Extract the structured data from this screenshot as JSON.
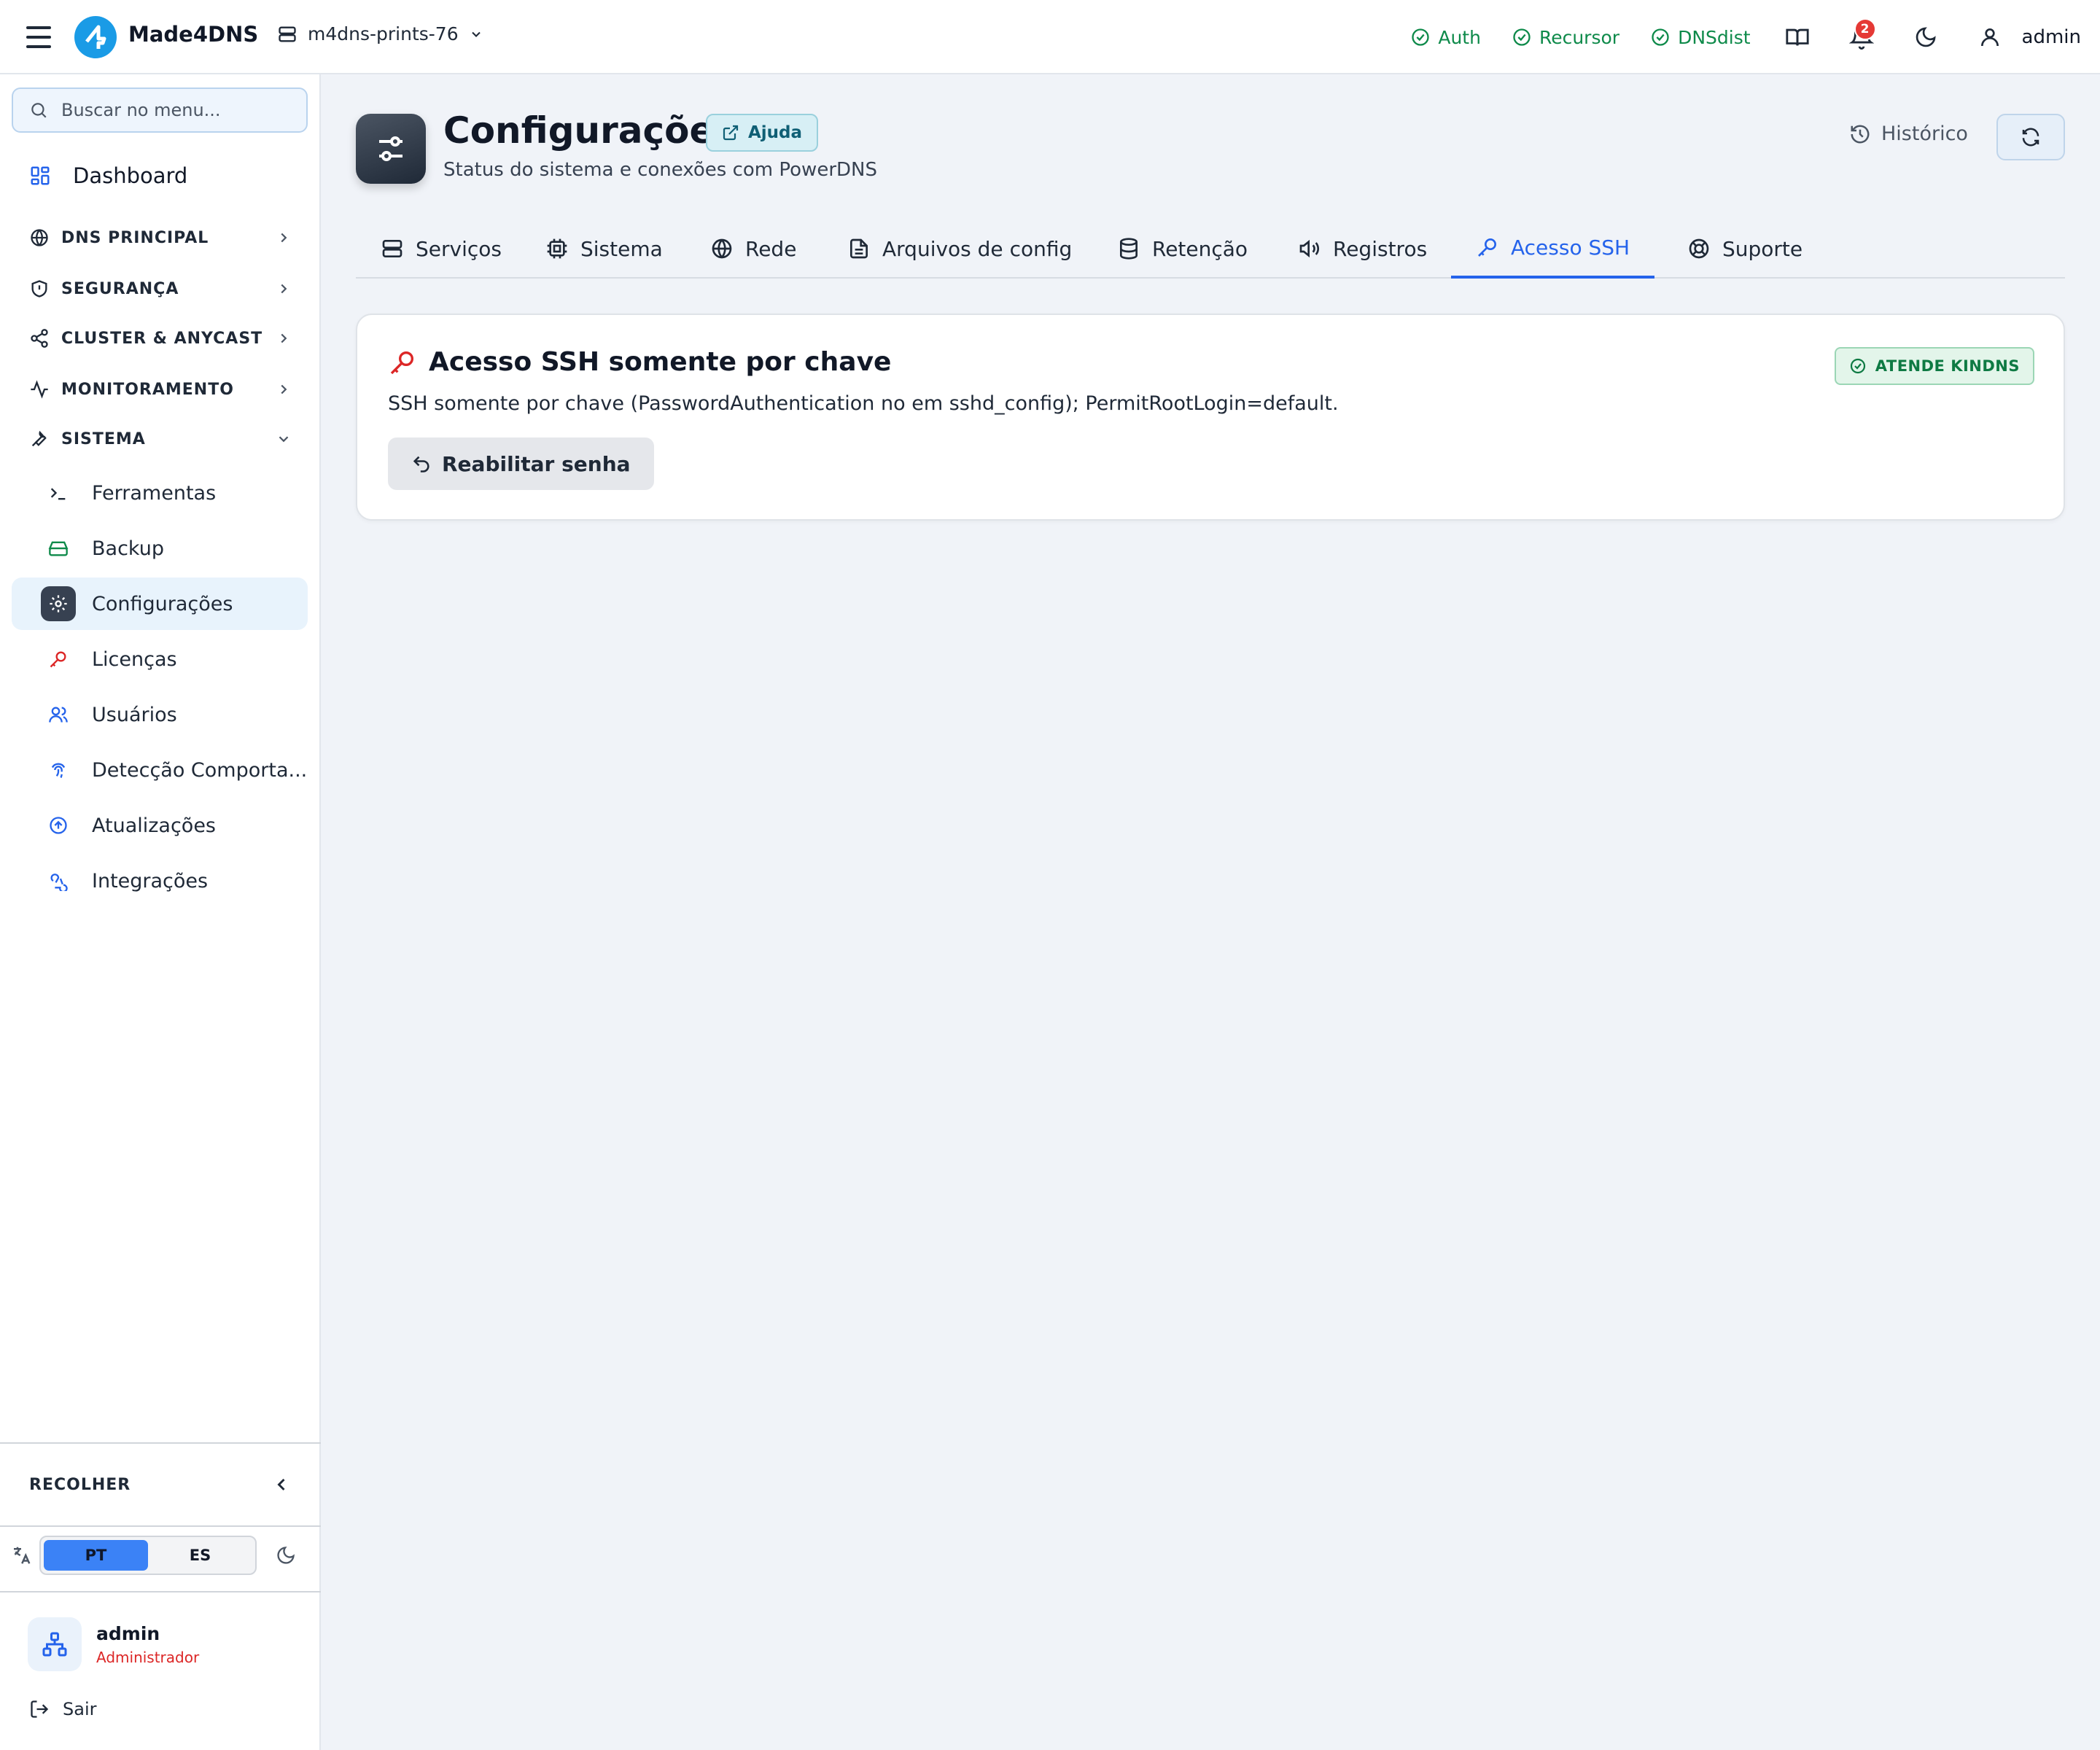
{
  "header": {
    "brand": "Made4DNS",
    "server": "m4dns-prints-76",
    "status": [
      {
        "label": "Auth"
      },
      {
        "label": "Recursor"
      },
      {
        "label": "DNSdist"
      }
    ],
    "notification_count": "2",
    "user": "admin"
  },
  "sidebar": {
    "search_placeholder": "Buscar no menu...",
    "dashboard": "Dashboard",
    "sections": [
      {
        "label": "DNS PRINCIPAL"
      },
      {
        "label": "SEGURANÇA"
      },
      {
        "label": "CLUSTER & ANYCAST"
      },
      {
        "label": "MONITORAMENTO"
      },
      {
        "label": "SISTEMA"
      }
    ],
    "items": [
      {
        "label": "Ferramentas"
      },
      {
        "label": "Backup"
      },
      {
        "label": "Configurações"
      },
      {
        "label": "Licenças"
      },
      {
        "label": "Usuários"
      },
      {
        "label": "Detecção Comporta..."
      },
      {
        "label": "Atualizações"
      },
      {
        "label": "Integrações"
      }
    ],
    "collapse_label": "RECOLHER",
    "languages": [
      "PT",
      "ES"
    ],
    "active_language": "PT",
    "user_name": "admin",
    "user_role": "Administrador",
    "logout": "Sair"
  },
  "page": {
    "title": "Configurações",
    "help": "Ajuda",
    "subtitle": "Status do sistema e conexões com PowerDNS",
    "history": "Histórico",
    "tabs": [
      {
        "label": "Serviços"
      },
      {
        "label": "Sistema"
      },
      {
        "label": "Rede"
      },
      {
        "label": "Arquivos de config"
      },
      {
        "label": "Retenção"
      },
      {
        "label": "Registros"
      },
      {
        "label": "Acesso SSH"
      },
      {
        "label": "Suporte"
      }
    ],
    "active_tab": "Acesso SSH"
  },
  "card": {
    "title": "Acesso SSH somente por chave",
    "badge": "ATENDE KINDNS",
    "description": "SSH somente por chave (PasswordAuthentication no em sshd_config); PermitRootLogin=default.",
    "button": "Reabilitar senha"
  },
  "colors": {
    "accent": "#2563eb",
    "success": "#0e8a4a",
    "danger": "#dc2626",
    "brand": "#1a9be6"
  }
}
